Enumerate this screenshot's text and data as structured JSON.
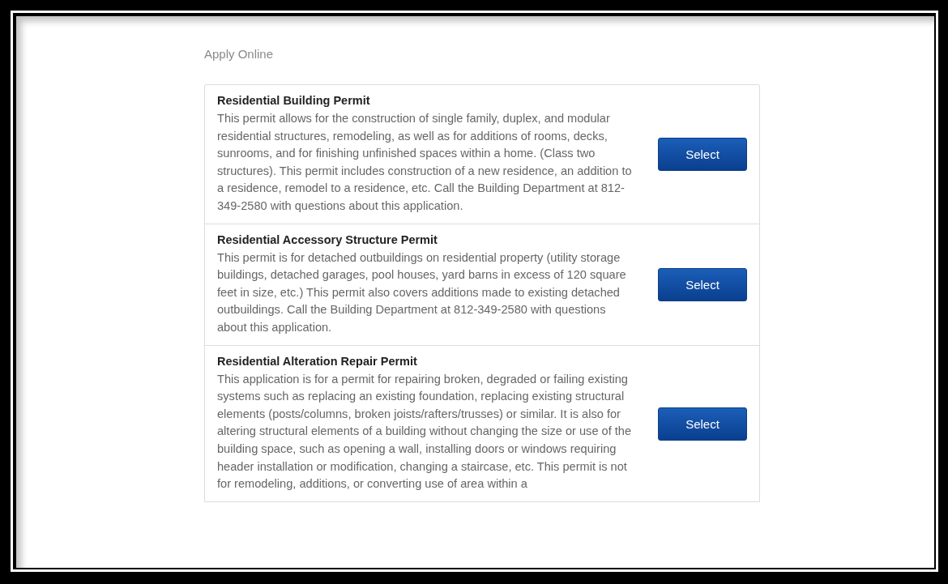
{
  "heading": "Apply Online",
  "permits": [
    {
      "title": "Residential Building Permit",
      "description": "This permit allows for the construction of single family, duplex, and modular residential structures, remodeling, as well as for additions of rooms, decks, sunrooms, and for finishing unfinished spaces within a home. (Class two structures). This permit includes construction of a new residence, an addition to a residence, remodel to a residence, etc. Call the Building Department at 812-349-2580 with questions about this application.",
      "button": "Select"
    },
    {
      "title": "Residential Accessory Structure Permit",
      "description": "This permit is for detached outbuildings on residential property (utility storage buildings, detached garages, pool houses, yard barns in excess of 120 square feet in size, etc.) This permit also covers additions made to existing detached outbuildings. Call the Building Department at 812-349-2580 with questions about this application.",
      "button": "Select"
    },
    {
      "title": "Residential Alteration Repair Permit",
      "description": "This application is for a permit for repairing broken, degraded or failing existing systems such as replacing an existing foundation, replacing existing structural elements (posts/columns, broken joists/rafters/trusses) or similar. It is also for altering structural elements of a building without changing the size or use of the building space, such as opening a wall, installing doors or windows requiring header installation or modification, changing a staircase, etc. This permit is not for remodeling, additions, or converting use of area within a",
      "button": "Select"
    }
  ]
}
